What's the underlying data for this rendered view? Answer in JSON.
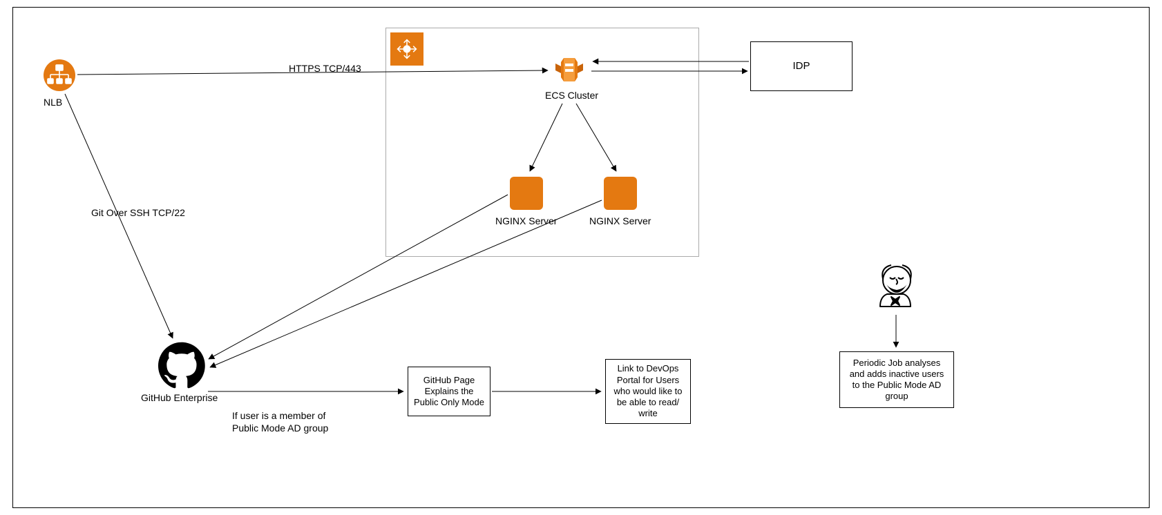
{
  "nodes": {
    "nlb": {
      "label": "NLB"
    },
    "ecs_cluster": {
      "label": "ECS Cluster"
    },
    "ecs_badge_icon": "elb-icon",
    "nginx1": {
      "label": "NGINX Server"
    },
    "nginx2": {
      "label": "NGINX Server"
    },
    "idp": {
      "label": "IDP"
    },
    "github": {
      "label": "GitHub Enterprise"
    },
    "github_page": {
      "label": "GitHub Page\nExplains the\nPublic Only Mode"
    },
    "devops_link": {
      "label": "Link to DevOps\nPortal for Users\nwho would like to\nbe able to read/\nwrite"
    },
    "jenkins_job": {
      "label": "Periodic Job analyses\nand adds inactive\nusers to the Public\nMode AD group"
    }
  },
  "edges": {
    "nlb_to_ecs": {
      "label": "HTTPS TCP/443"
    },
    "nlb_to_github": {
      "label": "Git Over SSH TCP/22"
    },
    "github_to_page": {
      "label": "If user is a member of\nPublic Mode AD group"
    }
  },
  "colors": {
    "aws_orange": "#e47911",
    "stroke": "#000000",
    "cluster_border": "#aaaaaa"
  }
}
